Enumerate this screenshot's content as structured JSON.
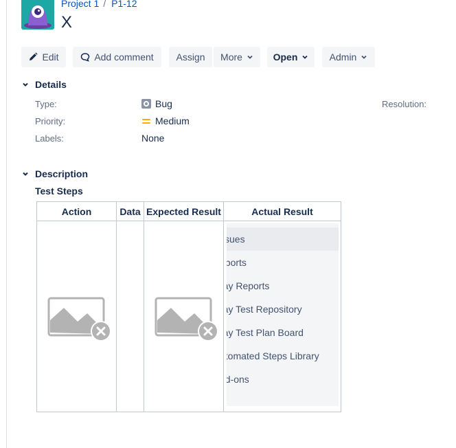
{
  "breadcrumb": {
    "project": "Project 1",
    "separator": "/",
    "issue_key": "P1-12"
  },
  "issue": {
    "title": "X"
  },
  "toolbar": {
    "edit": "Edit",
    "add_comment": "Add comment",
    "assign": "Assign",
    "more": "More",
    "status": "Open",
    "admin": "Admin"
  },
  "details": {
    "heading": "Details",
    "type_label": "Type:",
    "type_value": "Bug",
    "priority_label": "Priority:",
    "priority_value": "Medium",
    "labels_label": "Labels:",
    "labels_value": "None",
    "resolution_label": "Resolution:"
  },
  "description": {
    "heading": "Description",
    "steps_title": "Test Steps",
    "columns": [
      "Action",
      "Data",
      "Expected Result",
      "Actual Result"
    ]
  },
  "dropdown_menu": {
    "items": [
      "ssues",
      "eports",
      "ray Reports",
      "ray Test Repository",
      "ray Test Plan Board",
      "utomated Steps Library",
      "dd-ons"
    ]
  },
  "colors": {
    "link": "#0052cc",
    "text": "#172b4d",
    "button_bg": "#f4f5f7",
    "priority_medium": "#ffab00",
    "bug_icon": "#8993a4",
    "avatar_bg": "#1ca8a4"
  },
  "icons": [
    "project-avatar-icon",
    "pencil-icon",
    "comment-icon",
    "chevron-down-icon",
    "bug-icon",
    "priority-medium-icon",
    "broken-image-icon"
  ]
}
